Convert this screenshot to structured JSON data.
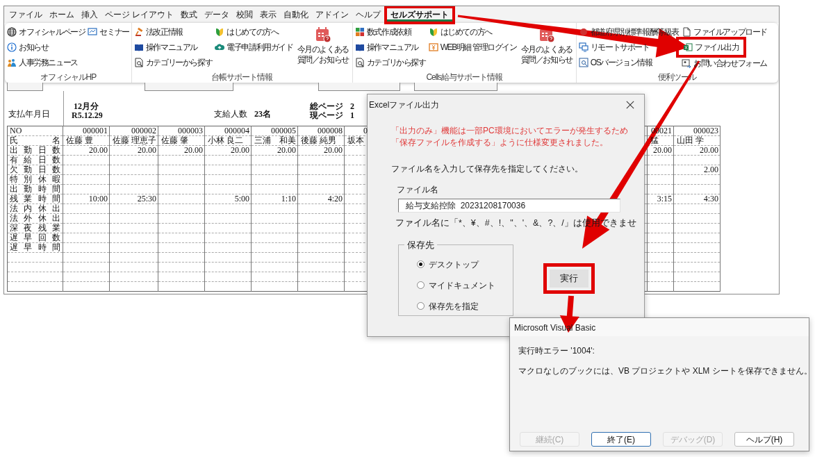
{
  "excel": {
    "menu_tabs": [
      {
        "label": "ファイル",
        "selected": false,
        "highlighted": false
      },
      {
        "label": "ホーム",
        "selected": false,
        "highlighted": false
      },
      {
        "label": "挿入",
        "selected": false,
        "highlighted": false
      },
      {
        "label": "ページ レイアウト",
        "selected": false,
        "highlighted": false
      },
      {
        "label": "数式",
        "selected": false,
        "highlighted": false
      },
      {
        "label": "データ",
        "selected": false,
        "highlighted": false
      },
      {
        "label": "校閲",
        "selected": false,
        "highlighted": false
      },
      {
        "label": "表示",
        "selected": false,
        "highlighted": false
      },
      {
        "label": "自動化",
        "selected": false,
        "highlighted": false
      },
      {
        "label": "アドイン",
        "selected": false,
        "highlighted": false
      },
      {
        "label": "ヘルプ",
        "selected": false,
        "highlighted": false
      },
      {
        "label": "セルズサポート",
        "selected": true,
        "highlighted": true
      }
    ],
    "ribbon_groups": [
      {
        "label": "オフィシャルHP",
        "columns": [
          [
            {
              "label": "オフィシャルページ",
              "highlighted": false
            },
            {
              "label": "お知らせ",
              "highlighted": false
            },
            {
              "label": "人事労務ニュース",
              "highlighted": false
            }
          ],
          [
            {
              "label": "セミナー",
              "highlighted": false
            }
          ]
        ]
      },
      {
        "label": "台帳サポート情報",
        "columns": [
          [
            {
              "label": "法改正情報",
              "highlighted": false
            },
            {
              "label": "操作マニュアル",
              "highlighted": false
            },
            {
              "label": "カテゴリーから探す",
              "highlighted": false
            }
          ],
          [
            {
              "label": "はじめての方へ",
              "highlighted": false
            },
            {
              "label": "電子申請利用ガイド",
              "highlighted": false
            }
          ]
        ],
        "large_button": [
          "今月のよくある",
          "質問／お知らせ"
        ]
      },
      {
        "label": "Cells給与サポート情報",
        "columns": [
          [
            {
              "label": "数式作成依頼",
              "highlighted": false
            },
            {
              "label": "操作マニュアル",
              "highlighted": false
            },
            {
              "label": "カテゴリから探す",
              "highlighted": false
            }
          ],
          [
            {
              "label": "はじめての方へ",
              "highlighted": false
            },
            {
              "label": "WEB明細 管理ログイン",
              "highlighted": false
            }
          ]
        ],
        "large_button": [
          "今月のよくある",
          "質問／お知らせ"
        ]
      },
      {
        "label": "便利ツール",
        "columns": [
          [
            {
              "label": "都道府県別標準報酬等級表",
              "highlighted": false
            },
            {
              "label": "リモートサポート",
              "highlighted": false
            },
            {
              "label": "OSバージョン情報",
              "highlighted": false
            }
          ],
          [
            {
              "label": "ファイルアップロード",
              "highlighted": false
            },
            {
              "label": "ファイル出力",
              "highlighted": true
            },
            {
              "label": "お問い合わせフォーム",
              "highlighted": false
            }
          ]
        ]
      }
    ],
    "sheet": {
      "date_label": "支払年月日",
      "month": "12月分",
      "date": "R5.12.29",
      "count_label": "支給人数",
      "count": "23名",
      "total_pages_label": "総ページ",
      "current_page_label": "現ページ",
      "total_pages": "2",
      "current_page": "1",
      "header_labels": [
        "NO",
        "氏名"
      ],
      "row_labels": [
        "出勤日数",
        "有給日数",
        "欠勤日数",
        "特別休暇",
        "出勤時間",
        "残業時間",
        "法内休出",
        "法外休出",
        "深夜残業",
        "遅早回数",
        "遅早時間"
      ],
      "columns": [
        {
          "no": "000001",
          "name": "佐藤 豊",
          "attendance_days": "20.00",
          "overtime_hours": "10:00"
        },
        {
          "no": "000002",
          "name": "佐藤 理恵子",
          "attendance_days": "20.00",
          "overtime_hours": "25:30"
        },
        {
          "no": "000003",
          "name": "佐藤 肇",
          "attendance_days": "20.00"
        },
        {
          "no": "000004",
          "name": "小林 良二",
          "attendance_days": "20.00",
          "overtime_hours": "5:00"
        },
        {
          "no": "000005",
          "name": "三浦　和美",
          "attendance_days": "20.00",
          "overtime_hours": "1:10"
        },
        {
          "no": "000008",
          "name": "後藤 純男",
          "attendance_days": "20.00",
          "overtime_hours": "4:20"
        },
        {
          "no": "0",
          "name": "坂本"
        },
        {
          "no": "00021",
          "name": "猛",
          "attendance_days": "20.00",
          "overtime_hours": "3:15"
        },
        {
          "no": "000023",
          "name": "山田 学",
          "attendance_days": "20.00",
          "absence_days": "2.00",
          "overtime_hours": "4:30"
        }
      ]
    }
  },
  "export_dialog": {
    "title": "Excelファイル出力",
    "warning": [
      "「出力のみ」機能は一部PC環境においてエラーが発生するため",
      "「保存ファイルを作成する」ように仕様変更されました。"
    ],
    "instruction": "ファイル名を入力して保存先を指定してください。",
    "file_name_label": "ファイル名",
    "file_name": "給与支給控除  20231208170036",
    "note": "ファイル名に「*、¥、#、!、\"、'、&、?、/」は使用できませ",
    "destination": {
      "label": "保存先",
      "options": [
        {
          "label": "デスクトップ",
          "selected": true
        },
        {
          "label": "マイドキュメント",
          "selected": false
        },
        {
          "label": "保存先を指定",
          "selected": false
        }
      ]
    },
    "run_button": {
      "label": "実行",
      "highlighted": true
    }
  },
  "error_dialog": {
    "title": "Microsoft Visual Basic",
    "error": "実行時エラー '1004':",
    "message": "マクロなしのブックには、VB プロジェクトや XLM シートを保存できません。",
    "buttons": [
      {
        "label": "継続(C)",
        "disabled": true,
        "default": false
      },
      {
        "label": "終了(E)",
        "disabled": false,
        "default": true
      },
      {
        "label": "デバッグ(D)",
        "disabled": true,
        "default": false
      },
      {
        "label": "ヘルプ(H)",
        "disabled": false,
        "default": false
      }
    ]
  }
}
